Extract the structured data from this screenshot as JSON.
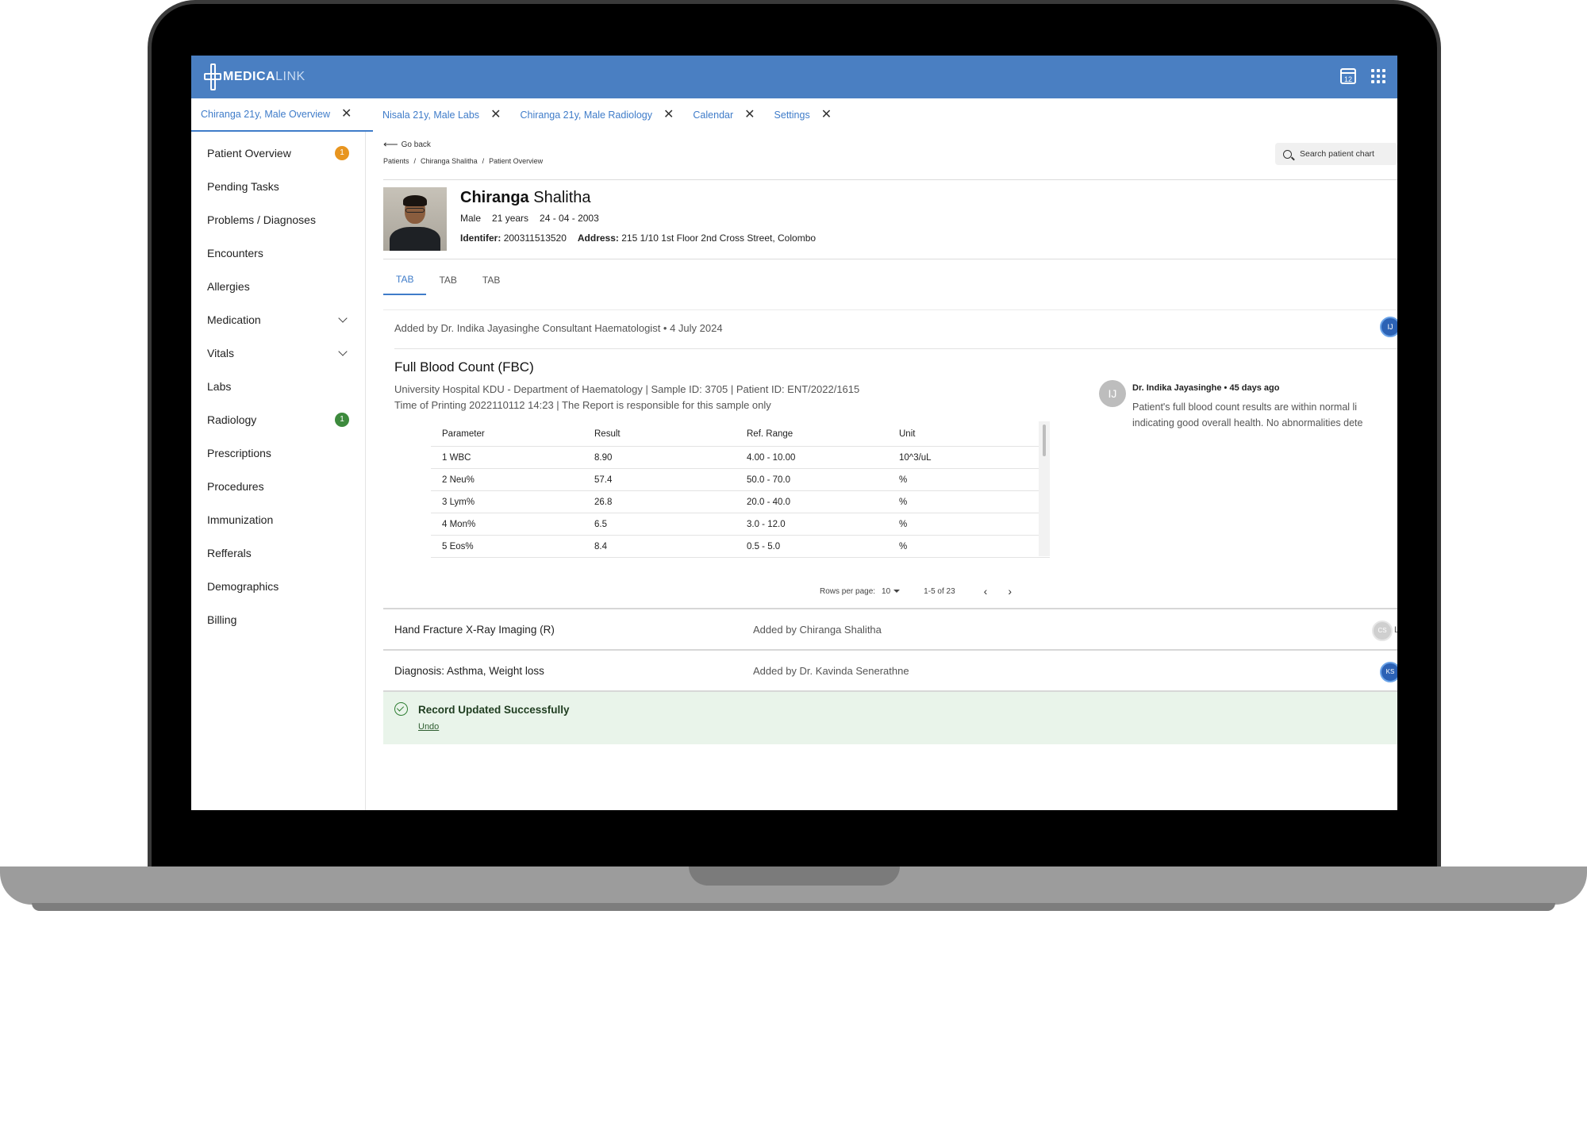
{
  "app": {
    "logo_primary": "MEDICA",
    "logo_secondary": "LINK",
    "calendar_day": "12"
  },
  "tabs": [
    {
      "label": "Chiranga 21y, Male Overview"
    },
    {
      "label": "Nisala 21y, Male Labs"
    },
    {
      "label": "Chiranga 21y, Male Radiology"
    },
    {
      "label": "Calendar"
    },
    {
      "label": "Settings"
    }
  ],
  "sidebar": {
    "items": [
      {
        "label": "Patient Overview",
        "badge": "1"
      },
      {
        "label": "Pending Tasks"
      },
      {
        "label": "Problems / Diagnoses"
      },
      {
        "label": "Encounters"
      },
      {
        "label": "Allergies"
      },
      {
        "label": "Medication"
      },
      {
        "label": "Vitals"
      },
      {
        "label": "Labs"
      },
      {
        "label": "Radiology",
        "badge": "1"
      },
      {
        "label": "Prescriptions"
      },
      {
        "label": "Procedures"
      },
      {
        "label": "Immunization"
      },
      {
        "label": "Refferals"
      },
      {
        "label": "Demographics"
      },
      {
        "label": "Billing"
      }
    ]
  },
  "nav": {
    "go_back": "Go back",
    "breadcrumbs": [
      "Patients",
      "/",
      "Chiranga Shalitha",
      "/",
      "Patient Overview"
    ],
    "search_placeholder": "Search patient chart"
  },
  "patient": {
    "first_name": "Chiranga",
    "last_name": "Shalitha",
    "gender": "Male",
    "age": "21 years",
    "dob": "24 - 04 - 2003",
    "identifier_label": "Identifer:",
    "identifier": "200311513520",
    "address_label": "Address:",
    "address": "215 1/10 1st Floor 2nd Cross Street, Colombo"
  },
  "subtabs": [
    "TAB",
    "TAB",
    "TAB"
  ],
  "record": {
    "added_by": "Added by Dr. Indika Jayasinghe Consultant Haematologist  • 4 July 2024",
    "avatar": "IJ",
    "title": "Full Blood Count (FBC)",
    "line1": "University Hospital KDU - Department of Haematology | Sample ID: 3705 | Patient ID: ENT/2022/1615",
    "line2": "Time of Printing 2022110112 14:23  | The Report is responsible for this sample only",
    "table": {
      "headers": [
        "Parameter",
        "Result",
        "Ref. Range",
        "Unit"
      ],
      "rows": [
        [
          "1 WBC",
          "8.90",
          "4.00 - 10.00",
          "10^3/uL"
        ],
        [
          "2 Neu%",
          "57.4",
          "50.0 - 70.0",
          "%"
        ],
        [
          "3 Lym%",
          "26.8",
          "20.0 - 40.0",
          "%"
        ],
        [
          "4 Mon%",
          "6.5",
          "3.0 - 12.0",
          "%"
        ],
        [
          "5 Eos%",
          "8.4",
          "0.5 - 5.0",
          "%"
        ]
      ]
    },
    "pager": {
      "rows_label": "Rows per page:",
      "rows_value": "10",
      "range": "1-5 of 23"
    },
    "comment": {
      "avatar": "IJ",
      "author": "Dr. Indika Jayasinghe • 45 days ago",
      "line1": "Patient's full blood count results are within normal li",
      "line2": "indicating good overall health. No abnormalities dete"
    }
  },
  "list": [
    {
      "title": "Hand Fracture X-Ray Imaging (R)",
      "added_by": "Added by Chiranga Shalitha",
      "avatar": "CS",
      "extra": "L"
    },
    {
      "title": "Diagnosis: Asthma, Weight loss",
      "added_by": "Added by Dr. Kavinda Senerathne",
      "avatar": "KS"
    }
  ],
  "toast": {
    "message": "Record Updated Successfully",
    "action": "Undo"
  },
  "colors": {
    "brand": "#4a7fc2",
    "accent": "#3f7cc9",
    "badge_orange": "#e8951f",
    "badge_green": "#3d8a3d",
    "success_bg": "#e9f4ea"
  }
}
